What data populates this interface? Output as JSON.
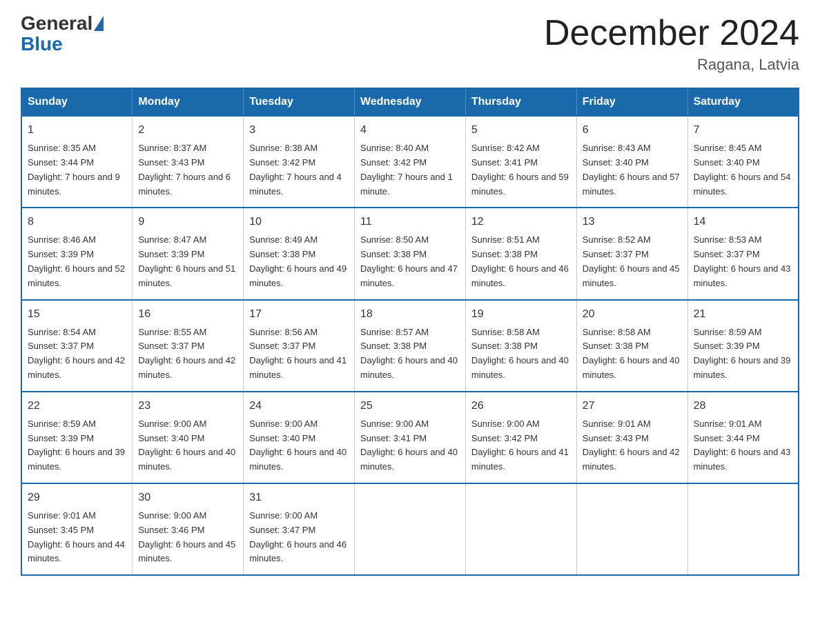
{
  "logo": {
    "general": "General",
    "blue": "Blue"
  },
  "title": "December 2024",
  "subtitle": "Ragana, Latvia",
  "weekdays": [
    "Sunday",
    "Monday",
    "Tuesday",
    "Wednesday",
    "Thursday",
    "Friday",
    "Saturday"
  ],
  "weeks": [
    [
      {
        "day": "1",
        "sunrise": "8:35 AM",
        "sunset": "3:44 PM",
        "daylight": "7 hours and 9 minutes."
      },
      {
        "day": "2",
        "sunrise": "8:37 AM",
        "sunset": "3:43 PM",
        "daylight": "7 hours and 6 minutes."
      },
      {
        "day": "3",
        "sunrise": "8:38 AM",
        "sunset": "3:42 PM",
        "daylight": "7 hours and 4 minutes."
      },
      {
        "day": "4",
        "sunrise": "8:40 AM",
        "sunset": "3:42 PM",
        "daylight": "7 hours and 1 minute."
      },
      {
        "day": "5",
        "sunrise": "8:42 AM",
        "sunset": "3:41 PM",
        "daylight": "6 hours and 59 minutes."
      },
      {
        "day": "6",
        "sunrise": "8:43 AM",
        "sunset": "3:40 PM",
        "daylight": "6 hours and 57 minutes."
      },
      {
        "day": "7",
        "sunrise": "8:45 AM",
        "sunset": "3:40 PM",
        "daylight": "6 hours and 54 minutes."
      }
    ],
    [
      {
        "day": "8",
        "sunrise": "8:46 AM",
        "sunset": "3:39 PM",
        "daylight": "6 hours and 52 minutes."
      },
      {
        "day": "9",
        "sunrise": "8:47 AM",
        "sunset": "3:39 PM",
        "daylight": "6 hours and 51 minutes."
      },
      {
        "day": "10",
        "sunrise": "8:49 AM",
        "sunset": "3:38 PM",
        "daylight": "6 hours and 49 minutes."
      },
      {
        "day": "11",
        "sunrise": "8:50 AM",
        "sunset": "3:38 PM",
        "daylight": "6 hours and 47 minutes."
      },
      {
        "day": "12",
        "sunrise": "8:51 AM",
        "sunset": "3:38 PM",
        "daylight": "6 hours and 46 minutes."
      },
      {
        "day": "13",
        "sunrise": "8:52 AM",
        "sunset": "3:37 PM",
        "daylight": "6 hours and 45 minutes."
      },
      {
        "day": "14",
        "sunrise": "8:53 AM",
        "sunset": "3:37 PM",
        "daylight": "6 hours and 43 minutes."
      }
    ],
    [
      {
        "day": "15",
        "sunrise": "8:54 AM",
        "sunset": "3:37 PM",
        "daylight": "6 hours and 42 minutes."
      },
      {
        "day": "16",
        "sunrise": "8:55 AM",
        "sunset": "3:37 PM",
        "daylight": "6 hours and 42 minutes."
      },
      {
        "day": "17",
        "sunrise": "8:56 AM",
        "sunset": "3:37 PM",
        "daylight": "6 hours and 41 minutes."
      },
      {
        "day": "18",
        "sunrise": "8:57 AM",
        "sunset": "3:38 PM",
        "daylight": "6 hours and 40 minutes."
      },
      {
        "day": "19",
        "sunrise": "8:58 AM",
        "sunset": "3:38 PM",
        "daylight": "6 hours and 40 minutes."
      },
      {
        "day": "20",
        "sunrise": "8:58 AM",
        "sunset": "3:38 PM",
        "daylight": "6 hours and 40 minutes."
      },
      {
        "day": "21",
        "sunrise": "8:59 AM",
        "sunset": "3:39 PM",
        "daylight": "6 hours and 39 minutes."
      }
    ],
    [
      {
        "day": "22",
        "sunrise": "8:59 AM",
        "sunset": "3:39 PM",
        "daylight": "6 hours and 39 minutes."
      },
      {
        "day": "23",
        "sunrise": "9:00 AM",
        "sunset": "3:40 PM",
        "daylight": "6 hours and 40 minutes."
      },
      {
        "day": "24",
        "sunrise": "9:00 AM",
        "sunset": "3:40 PM",
        "daylight": "6 hours and 40 minutes."
      },
      {
        "day": "25",
        "sunrise": "9:00 AM",
        "sunset": "3:41 PM",
        "daylight": "6 hours and 40 minutes."
      },
      {
        "day": "26",
        "sunrise": "9:00 AM",
        "sunset": "3:42 PM",
        "daylight": "6 hours and 41 minutes."
      },
      {
        "day": "27",
        "sunrise": "9:01 AM",
        "sunset": "3:43 PM",
        "daylight": "6 hours and 42 minutes."
      },
      {
        "day": "28",
        "sunrise": "9:01 AM",
        "sunset": "3:44 PM",
        "daylight": "6 hours and 43 minutes."
      }
    ],
    [
      {
        "day": "29",
        "sunrise": "9:01 AM",
        "sunset": "3:45 PM",
        "daylight": "6 hours and 44 minutes."
      },
      {
        "day": "30",
        "sunrise": "9:00 AM",
        "sunset": "3:46 PM",
        "daylight": "6 hours and 45 minutes."
      },
      {
        "day": "31",
        "sunrise": "9:00 AM",
        "sunset": "3:47 PM",
        "daylight": "6 hours and 46 minutes."
      },
      null,
      null,
      null,
      null
    ]
  ]
}
